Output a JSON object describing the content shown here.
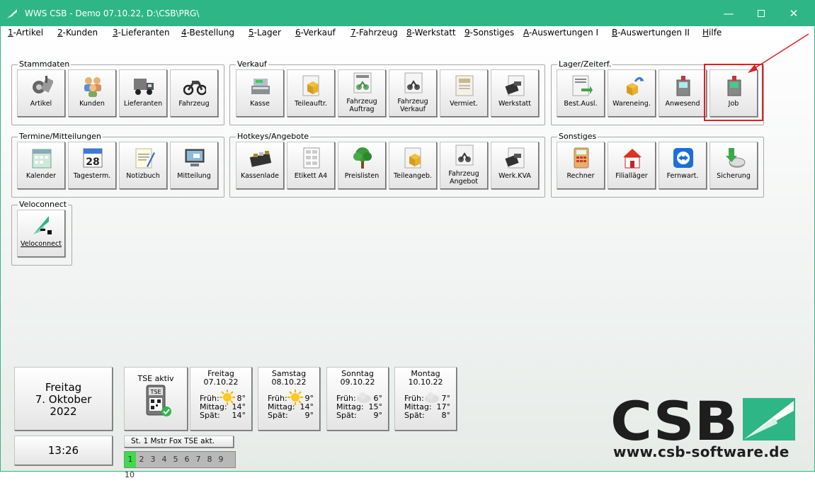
{
  "window": {
    "title": "WWS CSB - Demo  07.10.22, D:\\CSB\\PRG\\"
  },
  "menu": [
    {
      "k": "1",
      "t": "-Artikel"
    },
    {
      "k": "2",
      "t": "-Kunden"
    },
    {
      "k": "3",
      "t": "-Lieferanten"
    },
    {
      "k": "4",
      "t": "-Bestellung"
    },
    {
      "k": "5",
      "t": "-Lager"
    },
    {
      "k": "6",
      "t": "-Verkauf"
    },
    {
      "k": "7",
      "t": "-Fahrzeug"
    },
    {
      "k": "8",
      "t": "-Werkstatt"
    },
    {
      "k": "9",
      "t": "-Sonstiges"
    },
    {
      "k": "A",
      "t": "-Auswertungen I"
    },
    {
      "k": "B",
      "t": "-Auswertungen II"
    },
    {
      "k": "H",
      "t": "ilfe"
    }
  ],
  "groups": {
    "stammdaten": {
      "title": "Stammdaten",
      "tiles": [
        "Artikel",
        "Kunden",
        "Lieferanten",
        "Fahrzeug"
      ]
    },
    "verkauf": {
      "title": "Verkauf",
      "tiles": [
        "Kasse",
        "Teileauftr.",
        "Fahrzeug\nAuftrag",
        "Fahrzeug\nVerkauf",
        "Vermiet.",
        "Werkstatt"
      ]
    },
    "lager": {
      "title": "Lager/Zeiterf.",
      "tiles": [
        "Best.Ausl.",
        "Wareneing.",
        "Anwesend",
        "Job"
      ]
    },
    "termine": {
      "title": "Termine/Mitteilungen",
      "tiles": [
        "Kalender",
        "Tagesterm.",
        "Notizbuch",
        "Mitteilung"
      ]
    },
    "hotkeys": {
      "title": "Hotkeys/Angebote",
      "tiles": [
        "Kassenlade",
        "Etikett A4",
        "Preislisten",
        "Teileangeb.",
        "Fahrzeug\nAngebot",
        "Werk.KVA"
      ]
    },
    "sonstiges": {
      "title": "Sonstiges",
      "tiles": [
        "Rechner",
        "Filialläger",
        "Fernwart.",
        "Sicherung"
      ]
    },
    "veloconnect": {
      "title": "Veloconnect",
      "tiles": [
        "Veloconnect"
      ]
    }
  },
  "date_panel": {
    "weekday": "Freitag",
    "day_month": "7. Oktober",
    "year": "2022"
  },
  "time_panel": {
    "time": "13:26"
  },
  "tse": {
    "label": "TSE aktiv",
    "chip": "TSE",
    "status": "St. 1 Mstr Fox TSE akt."
  },
  "labels": {
    "frueh": "Früh:",
    "mittag": "Mittag:",
    "spaet": "Spät:"
  },
  "weather": [
    {
      "day": "Freitag",
      "date": "07.10.22",
      "frueh": "8°",
      "mittag": "14°",
      "spaet": "14°",
      "icon": "sun-icon"
    },
    {
      "day": "Samstag",
      "date": "08.10.22",
      "frueh": "9°",
      "mittag": "14°",
      "spaet": "9°",
      "icon": "sun-icon"
    },
    {
      "day": "Sonntag",
      "date": "09.10.22",
      "frueh": "6°",
      "mittag": "15°",
      "spaet": "9°",
      "icon": "cloud-icon"
    },
    {
      "day": "Montag",
      "date": "10.10.22",
      "frueh": "7°",
      "mittag": "17°",
      "spaet": "8°",
      "icon": "cloud-icon"
    }
  ],
  "segments": [
    "1",
    "2",
    "3",
    "4",
    "5",
    "6",
    "7",
    "8",
    "9",
    "10"
  ],
  "logo": {
    "text": "CSB",
    "url": "www.csb-software.de"
  },
  "colors": {
    "accent": "#2fb686",
    "highlight": "#e02020"
  }
}
